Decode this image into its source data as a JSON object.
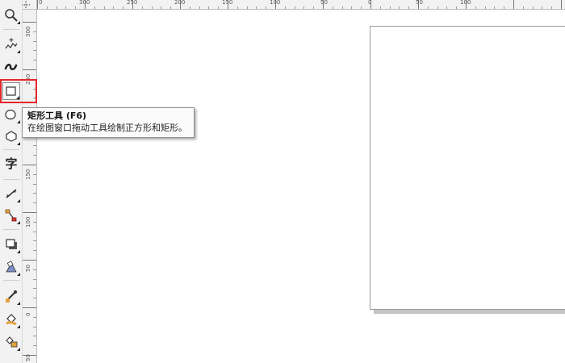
{
  "tools": [
    {
      "id": "zoom",
      "name": "zoom-tool",
      "icon": "zoom-icon",
      "flyout": true
    },
    {
      "id": "freehand",
      "name": "freehand-tool",
      "icon": "freehand-icon",
      "flyout": true
    },
    {
      "id": "smart-fill",
      "name": "artistic-media-tool",
      "icon": "artistic-media-icon",
      "flyout": false
    },
    {
      "id": "rectangle",
      "name": "rectangle-tool",
      "icon": "rectangle-icon",
      "flyout": true,
      "active": true
    },
    {
      "id": "ellipse",
      "name": "ellipse-tool",
      "icon": "ellipse-icon",
      "flyout": true
    },
    {
      "id": "polygon",
      "name": "polygon-tool",
      "icon": "polygon-icon",
      "flyout": true
    },
    {
      "id": "text",
      "name": "text-tool",
      "icon": "text-icon",
      "flyout": false,
      "glyph": "字"
    },
    {
      "id": "dimension",
      "name": "dimension-tool",
      "icon": "dimension-icon",
      "flyout": true
    },
    {
      "id": "connector",
      "name": "connector-tool",
      "icon": "connector-icon",
      "flyout": true
    },
    {
      "id": "shadow",
      "name": "drop-shadow-tool",
      "icon": "drop-shadow-icon",
      "flyout": true
    },
    {
      "id": "transparency",
      "name": "transparency-tool",
      "icon": "transparency-icon",
      "flyout": true
    },
    {
      "id": "eyedropper",
      "name": "eyedropper-tool",
      "icon": "eyedropper-icon",
      "flyout": true
    },
    {
      "id": "fill",
      "name": "fill-tool",
      "icon": "fill-icon",
      "flyout": true
    },
    {
      "id": "smartfill",
      "name": "smart-fill-tool",
      "icon": "smart-fill-icon",
      "flyout": true
    }
  ],
  "tooltip": {
    "title": "矩形工具 (F6)",
    "description": "在绘图窗口拖动工具绘制正方形和矩形。"
  },
  "ruler": {
    "horizontal_labels": [
      "300",
      "250",
      "200",
      "150",
      "100",
      "50",
      "0",
      "50",
      "100"
    ],
    "vertical_labels": [
      "300",
      "250",
      "200",
      "150",
      "100",
      "50",
      "0",
      "50"
    ]
  },
  "colors": {
    "highlight": "#e3262b",
    "ruler_bg": "#f2f2f2"
  }
}
